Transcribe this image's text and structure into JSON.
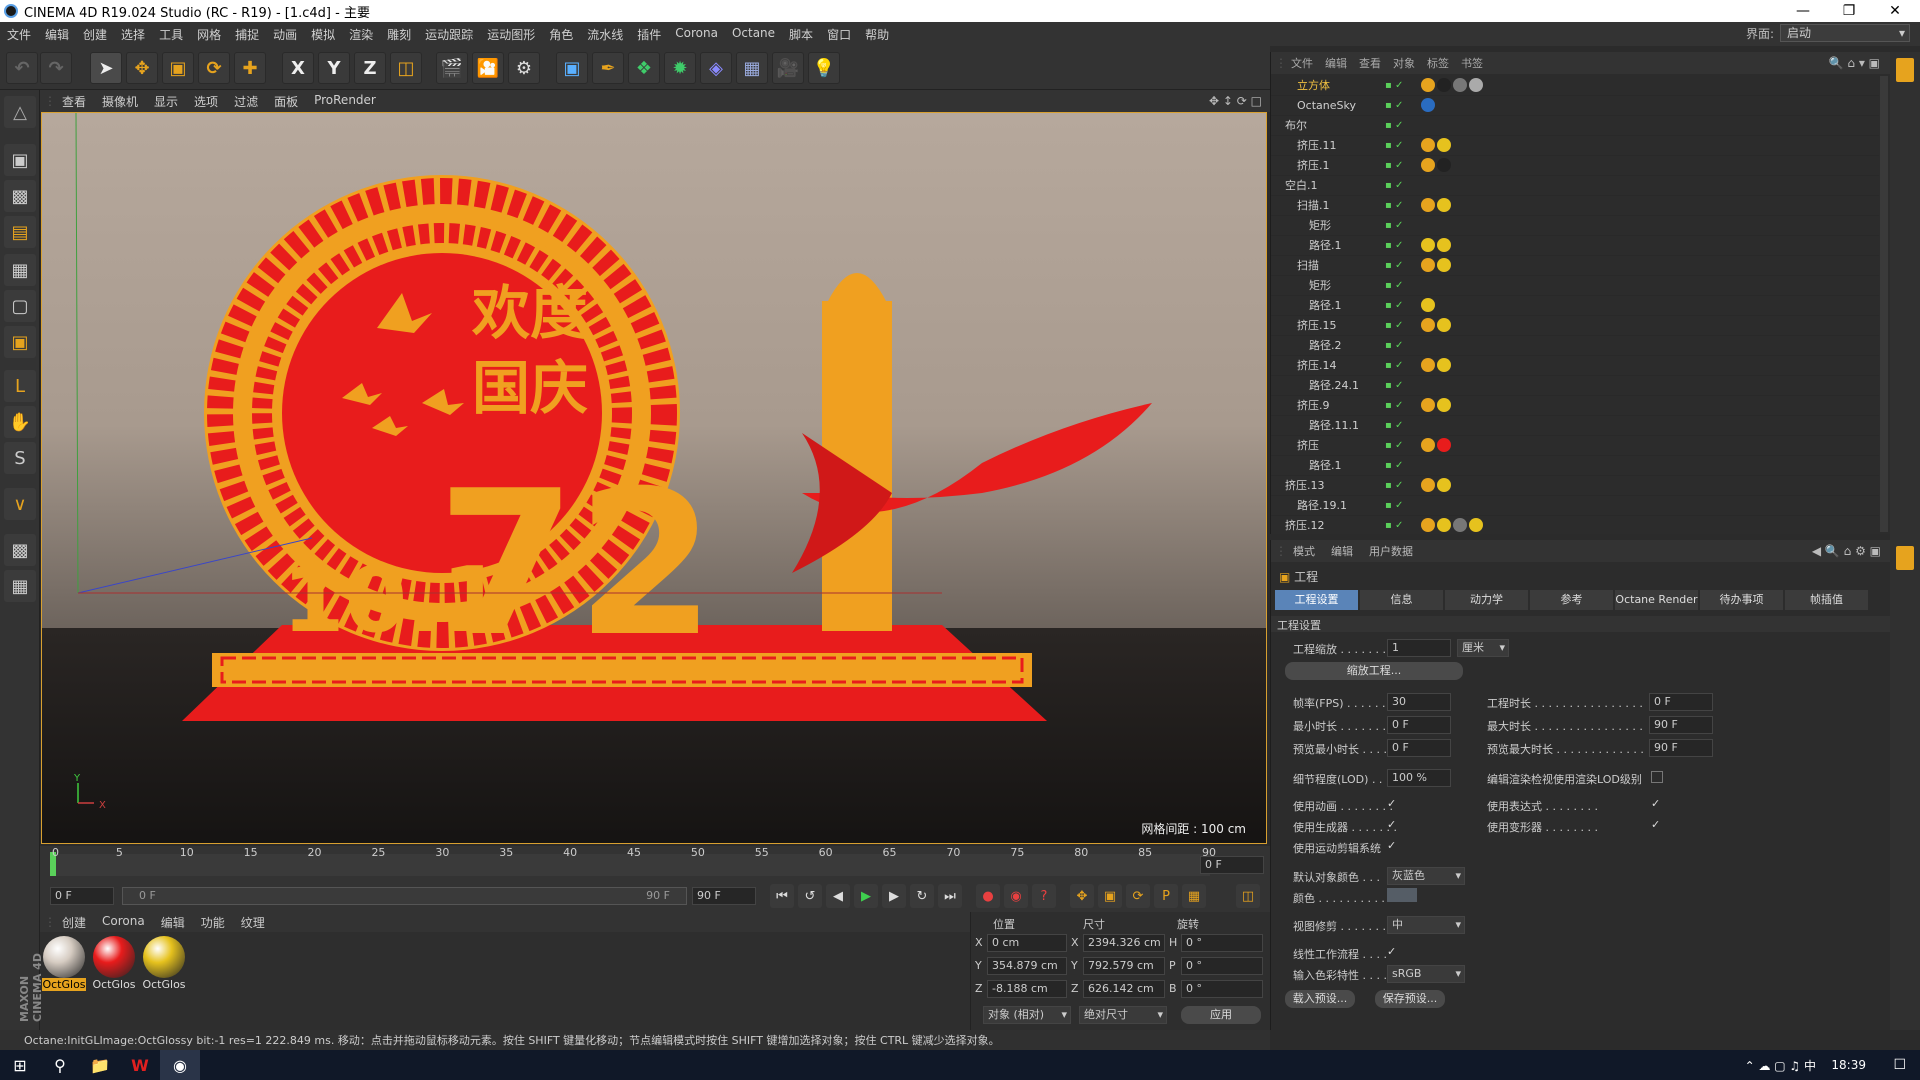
{
  "window": {
    "title": "CINEMA 4D R19.024 Studio (RC - R19) - [1.c4d] - 主要"
  },
  "menu": {
    "items": [
      "文件",
      "编辑",
      "创建",
      "选择",
      "工具",
      "网格",
      "捕捉",
      "动画",
      "模拟",
      "渲染",
      "雕刻",
      "运动跟踪",
      "运动图形",
      "角色",
      "流水线",
      "插件",
      "Corona",
      "Octane",
      "脚本",
      "窗口",
      "帮助"
    ],
    "layout_label": "界面:",
    "layout_value": "启动"
  },
  "viewport": {
    "menu": [
      "查看",
      "摄像机",
      "显示",
      "选项",
      "过滤",
      "面板",
      "ProRender"
    ],
    "grid_info": "网格间距 : 100 cm",
    "axis_y": "Y",
    "axis_x": "X",
    "scene_text_1": "欢度",
    "scene_text_2": "国庆",
    "scene_text_3": "72",
    "scene_text_4": "10.1"
  },
  "timeline": {
    "ticks": [
      "0",
      "5",
      "10",
      "15",
      "20",
      "25",
      "30",
      "35",
      "40",
      "45",
      "50",
      "55",
      "60",
      "65",
      "70",
      "75",
      "80",
      "85",
      "90"
    ],
    "current_frame": "0 F",
    "start_field": "0 F",
    "range_start": "0 F",
    "range_end": "90 F",
    "end_field": "90 F"
  },
  "materials": {
    "menu": [
      "创建",
      "Corona",
      "编辑",
      "功能",
      "纹理"
    ],
    "items": [
      {
        "name": "OctGlos",
        "color": "#d6ccc2"
      },
      {
        "name": "OctGlos",
        "color": "#e81c1c"
      },
      {
        "name": "OctGlos",
        "color": "#e6c21e"
      }
    ],
    "brand_1": "MAXON",
    "brand_2": "CINEMA 4D"
  },
  "coords": {
    "headers": [
      "位置",
      "尺寸",
      "旋转"
    ],
    "rows": [
      {
        "axis": "X",
        "pos": "0 cm",
        "size_axis": "X",
        "size": "2394.326 cm",
        "rot_axis": "H",
        "rot": "0 °"
      },
      {
        "axis": "Y",
        "pos": "354.879 cm",
        "size_axis": "Y",
        "size": "792.579 cm",
        "rot_axis": "P",
        "rot": "0 °"
      },
      {
        "axis": "Z",
        "pos": "-8.188 cm",
        "size_axis": "Z",
        "size": "626.142 cm",
        "rot_axis": "B",
        "rot": "0 °"
      }
    ],
    "mode_object": "对象 (相对)",
    "mode_size": "绝对尺寸",
    "apply": "应用"
  },
  "status": {
    "text": "Octane:InitGLImage:OctGlossy  bit:-1 res=1  222.849 ms.    移动：点击并拖动鼠标移动元素。按住 SHIFT 键量化移动；节点编辑模式时按住 SHIFT 键增加选择对象；按住 CTRL 键减少选择对象。"
  },
  "objects": {
    "menu": [
      "文件",
      "编辑",
      "查看",
      "对象",
      "标签",
      "书签"
    ],
    "rows": [
      {
        "name": "立方体",
        "indent": 1,
        "color": "#f0c040",
        "tags": [
          "#e6a31e",
          "#222",
          "#777",
          "#aaa"
        ]
      },
      {
        "name": "OctaneSky",
        "indent": 1,
        "color": "#cfcfcf",
        "tags": [
          "#2a6cc0"
        ]
      },
      {
        "name": "布尔",
        "indent": 0,
        "color": "#cfcfcf",
        "tags": []
      },
      {
        "name": "挤压.11",
        "indent": 1,
        "color": "#cfcfcf",
        "tags": [
          "#e6a31e",
          "#e6c21e"
        ]
      },
      {
        "name": "挤压.1",
        "indent": 1,
        "color": "#cfcfcf",
        "tags": [
          "#e6a31e",
          "#222"
        ]
      },
      {
        "name": "空白.1",
        "indent": 0,
        "color": "#cfcfcf",
        "tags": []
      },
      {
        "name": "扫描.1",
        "indent": 1,
        "color": "#cfcfcf",
        "tags": [
          "#e6a31e",
          "#e6c21e"
        ]
      },
      {
        "name": "矩形",
        "indent": 2,
        "color": "#cfcfcf",
        "tags": []
      },
      {
        "name": "路径.1",
        "indent": 2,
        "color": "#cfcfcf",
        "tags": [
          "#e6c21e",
          "#e6c21e"
        ]
      },
      {
        "name": "扫描",
        "indent": 1,
        "color": "#cfcfcf",
        "tags": [
          "#e6a31e",
          "#e6c21e"
        ]
      },
      {
        "name": "矩形",
        "indent": 2,
        "color": "#cfcfcf",
        "tags": []
      },
      {
        "name": "路径.1",
        "indent": 2,
        "color": "#cfcfcf",
        "tags": [
          "#e6c21e"
        ]
      },
      {
        "name": "挤压.15",
        "indent": 1,
        "color": "#cfcfcf",
        "tags": [
          "#e6a31e",
          "#e6c21e"
        ]
      },
      {
        "name": "路径.2",
        "indent": 2,
        "color": "#cfcfcf",
        "tags": []
      },
      {
        "name": "挤压.14",
        "indent": 1,
        "color": "#cfcfcf",
        "tags": [
          "#e6a31e",
          "#e6c21e"
        ]
      },
      {
        "name": "路径.24.1",
        "indent": 2,
        "color": "#cfcfcf",
        "tags": []
      },
      {
        "name": "挤压.9",
        "indent": 1,
        "color": "#cfcfcf",
        "tags": [
          "#e6a31e",
          "#e6c21e"
        ]
      },
      {
        "name": "路径.11.1",
        "indent": 2,
        "color": "#cfcfcf",
        "tags": []
      },
      {
        "name": "挤压",
        "indent": 1,
        "color": "#cfcfcf",
        "tags": [
          "#e6a31e",
          "#e81c1c"
        ]
      },
      {
        "name": "路径.1",
        "indent": 2,
        "color": "#cfcfcf",
        "tags": []
      },
      {
        "name": "挤压.13",
        "indent": 0,
        "color": "#cfcfcf",
        "tags": [
          "#e6a31e",
          "#e6c21e"
        ]
      },
      {
        "name": "路径.19.1",
        "indent": 1,
        "color": "#cfcfcf",
        "tags": []
      },
      {
        "name": "挤压.12",
        "indent": 0,
        "color": "#cfcfcf",
        "tags": [
          "#e6a31e",
          "#e6c21e",
          "#777",
          "#e6c21e"
        ]
      }
    ]
  },
  "attributes": {
    "menu": [
      "模式",
      "编辑",
      "用户数据"
    ],
    "section": "工程",
    "tabs": [
      "工程设置",
      "信息",
      "动力学",
      "参考",
      "Octane Render",
      "待办事项",
      "帧插值"
    ],
    "group": "工程设置",
    "scale_label": "工程缩放 . . . . . . .",
    "scale_value": "1",
    "scale_unit": "厘米",
    "scale_button": "缩放工程...",
    "fps_label": "帧率(FPS) . . . . . . .",
    "fps_value": "30",
    "proj_len_label": "工程时长 . . . . . . . . . . . . . . . .",
    "proj_len_value": "0 F",
    "min_label": "最小时长 . . . . . . . .",
    "min_value": "0 F",
    "max_label": "最大时长 . . . . . . . . . . . . . . . .",
    "max_value": "90 F",
    "prev_min_label": "预览最小时长 . . . .",
    "prev_min_value": "0 F",
    "prev_max_label": "预览最大时长 . . . . . . . . . . . . .",
    "prev_max_value": "90 F",
    "lod_label": "细节程度(LOD) . . . .",
    "lod_value": "100 %",
    "lod_render_label": "编辑渲染检视使用渲染LOD级别",
    "use_anim": "使用动画 . . . . . . . .",
    "use_expr": "使用表达式 . . . . . . . .",
    "use_gen": "使用生成器 . . . . . . .",
    "use_deform": "使用变形器 . . . . . . . .",
    "use_mograph": "使用运动剪辑系统",
    "default_color_label": "默认对象颜色 . . .",
    "default_color_value": "灰蓝色",
    "color_label": "颜色 . . . . . . . . . .",
    "view_clip_label": "视图修剪 . . . . . . . .",
    "view_clip_value": "中",
    "linear_label": "线性工作流程 . . . .",
    "input_color_label": "输入色彩特性 . . . .",
    "input_color_value": "sRGB",
    "load_preset": "载入预设...",
    "save_preset": "保存预设..."
  },
  "taskbar": {
    "time": "18:39"
  }
}
